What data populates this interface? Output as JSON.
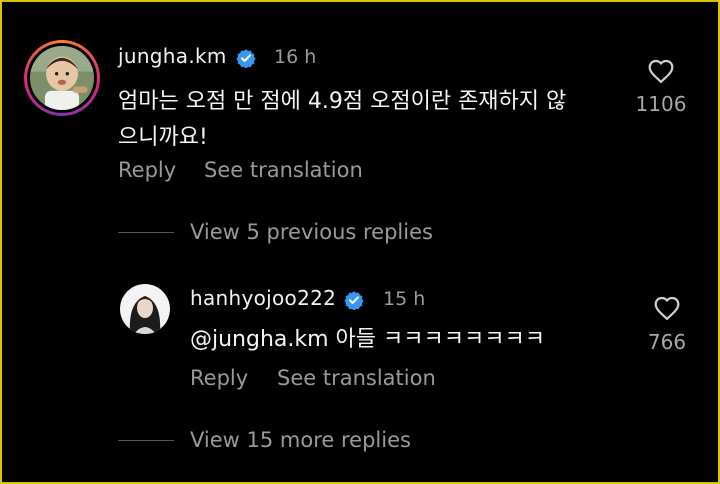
{
  "comment1": {
    "username": "jungha.km",
    "time": "16 h",
    "text_line1": "엄마는 오점 만 점에 4.9점 오점이란 존재하지 않",
    "text_line2": "으니까요!",
    "reply_label": "Reply",
    "translate_label": "See translation",
    "likes": "1106",
    "avatar_icon": "toddler-photo-avatar",
    "verified_icon": "verified-badge-icon"
  },
  "replies_toggle_previous": "View 5 previous replies",
  "reply1": {
    "username": "hanhyojoo222",
    "time": "15 h",
    "mention": "@jungha.km",
    "text": " 아들 ㅋㅋㅋㅋㅋㅋㅋㅋ",
    "reply_label": "Reply",
    "translate_label": "See translation",
    "likes": "766",
    "avatar_icon": "woman-photo-avatar",
    "verified_icon": "verified-badge-icon"
  },
  "replies_toggle_more": "View 15 more replies",
  "colors": {
    "background": "#000000",
    "primary_text": "#f5f5f5",
    "secondary_text": "#9a9a9a",
    "verified_blue": "#3897f0",
    "border": "#d9c400"
  }
}
